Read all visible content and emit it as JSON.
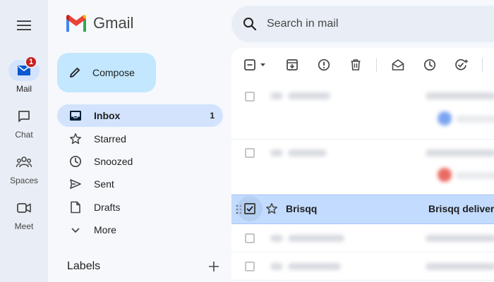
{
  "rail": {
    "items": [
      {
        "label": "Mail",
        "icon": "mail-icon",
        "badge": "1",
        "active": true
      },
      {
        "label": "Chat",
        "icon": "chat-icon"
      },
      {
        "label": "Spaces",
        "icon": "spaces-icon"
      },
      {
        "label": "Meet",
        "icon": "meet-icon"
      }
    ]
  },
  "brand": {
    "name": "Gmail"
  },
  "compose": {
    "label": "Compose"
  },
  "nav": {
    "items": [
      {
        "label": "Inbox",
        "icon": "inbox-icon",
        "count": "1",
        "active": true
      },
      {
        "label": "Starred",
        "icon": "star-icon"
      },
      {
        "label": "Snoozed",
        "icon": "clock-icon"
      },
      {
        "label": "Sent",
        "icon": "send-icon"
      },
      {
        "label": "Drafts",
        "icon": "draft-icon"
      },
      {
        "label": "More",
        "icon": "chevron-down-icon"
      }
    ],
    "labels_title": "Labels"
  },
  "search": {
    "placeholder": "Search in mail"
  },
  "toolbar": {
    "icons": [
      "select-checkbox-icon",
      "archive-icon",
      "report-spam-icon",
      "delete-icon",
      "mark-read-icon",
      "snooze-icon",
      "add-task-icon"
    ]
  },
  "messages": {
    "selected": {
      "sender": "Brisqq",
      "subject": "Brisqq deliver"
    }
  },
  "colors": {
    "accent_selected": "#d3e3fd",
    "compose_bg": "#c2e7ff",
    "badge": "#c5221f",
    "selected_row": "#c2dbff"
  }
}
